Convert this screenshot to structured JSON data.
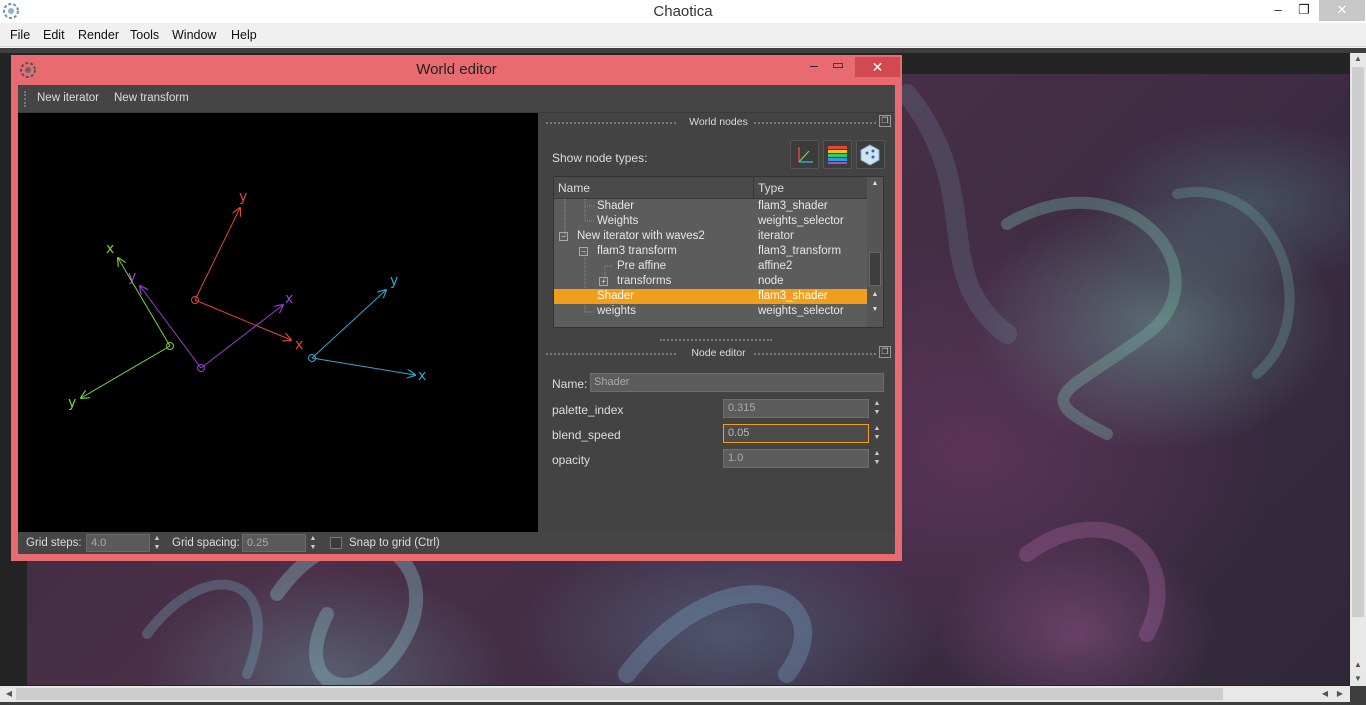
{
  "main_window": {
    "title": "Chaotica",
    "min_label": "–",
    "max_label": "❐",
    "close_label": "✕"
  },
  "menu": [
    "File",
    "Edit",
    "Render",
    "Tools",
    "Window",
    "Help"
  ],
  "world_editor": {
    "title": "World editor",
    "min_label": "–",
    "max_label": "▭",
    "close_label": "✕",
    "toolbar": {
      "new_iterator": "New iterator",
      "new_transform": "New transform"
    },
    "canvas": {
      "transforms": [
        {
          "color": "#e0473d",
          "x_label": "x",
          "y_label": "y"
        },
        {
          "color": "#9b3fd1",
          "x_label": "x",
          "y_label": "y"
        },
        {
          "color": "#7ad23a",
          "x_label": "x",
          "y_label": "y"
        },
        {
          "color": "#2fa8d0",
          "x_label": "x",
          "y_label": "y"
        }
      ]
    },
    "bottom": {
      "grid_steps_label": "Grid steps:",
      "grid_steps_value": "4.0",
      "grid_spacing_label": "Grid spacing:",
      "grid_spacing_value": "0.25",
      "snap_label": "Snap to grid (Ctrl)"
    },
    "world_nodes": {
      "header": "World nodes",
      "show_types_label": "Show node types:",
      "type_buttons": [
        "transform-type-icon",
        "palette-type-icon",
        "random-type-icon"
      ],
      "columns": {
        "name": "Name",
        "type": "Type"
      },
      "rows": [
        {
          "name": "Shader",
          "type": "flam3_shader"
        },
        {
          "name": "Weights",
          "type": "weights_selector"
        },
        {
          "name": "New iterator with waves2",
          "type": "iterator"
        },
        {
          "name": "flam3 transform",
          "type": "flam3_transform"
        },
        {
          "name": "Pre affine",
          "type": "affine2"
        },
        {
          "name": "transforms",
          "type": "node"
        },
        {
          "name": "Shader",
          "type": "flam3_shader"
        },
        {
          "name": "weights",
          "type": "weights_selector"
        }
      ]
    },
    "node_editor": {
      "header": "Node editor",
      "name_label": "Name:",
      "name_value": "Shader",
      "properties": [
        {
          "label": "palette_index",
          "value": "0.315"
        },
        {
          "label": "blend_speed",
          "value": "0.05"
        },
        {
          "label": "opacity",
          "value": "1.0"
        }
      ]
    }
  }
}
